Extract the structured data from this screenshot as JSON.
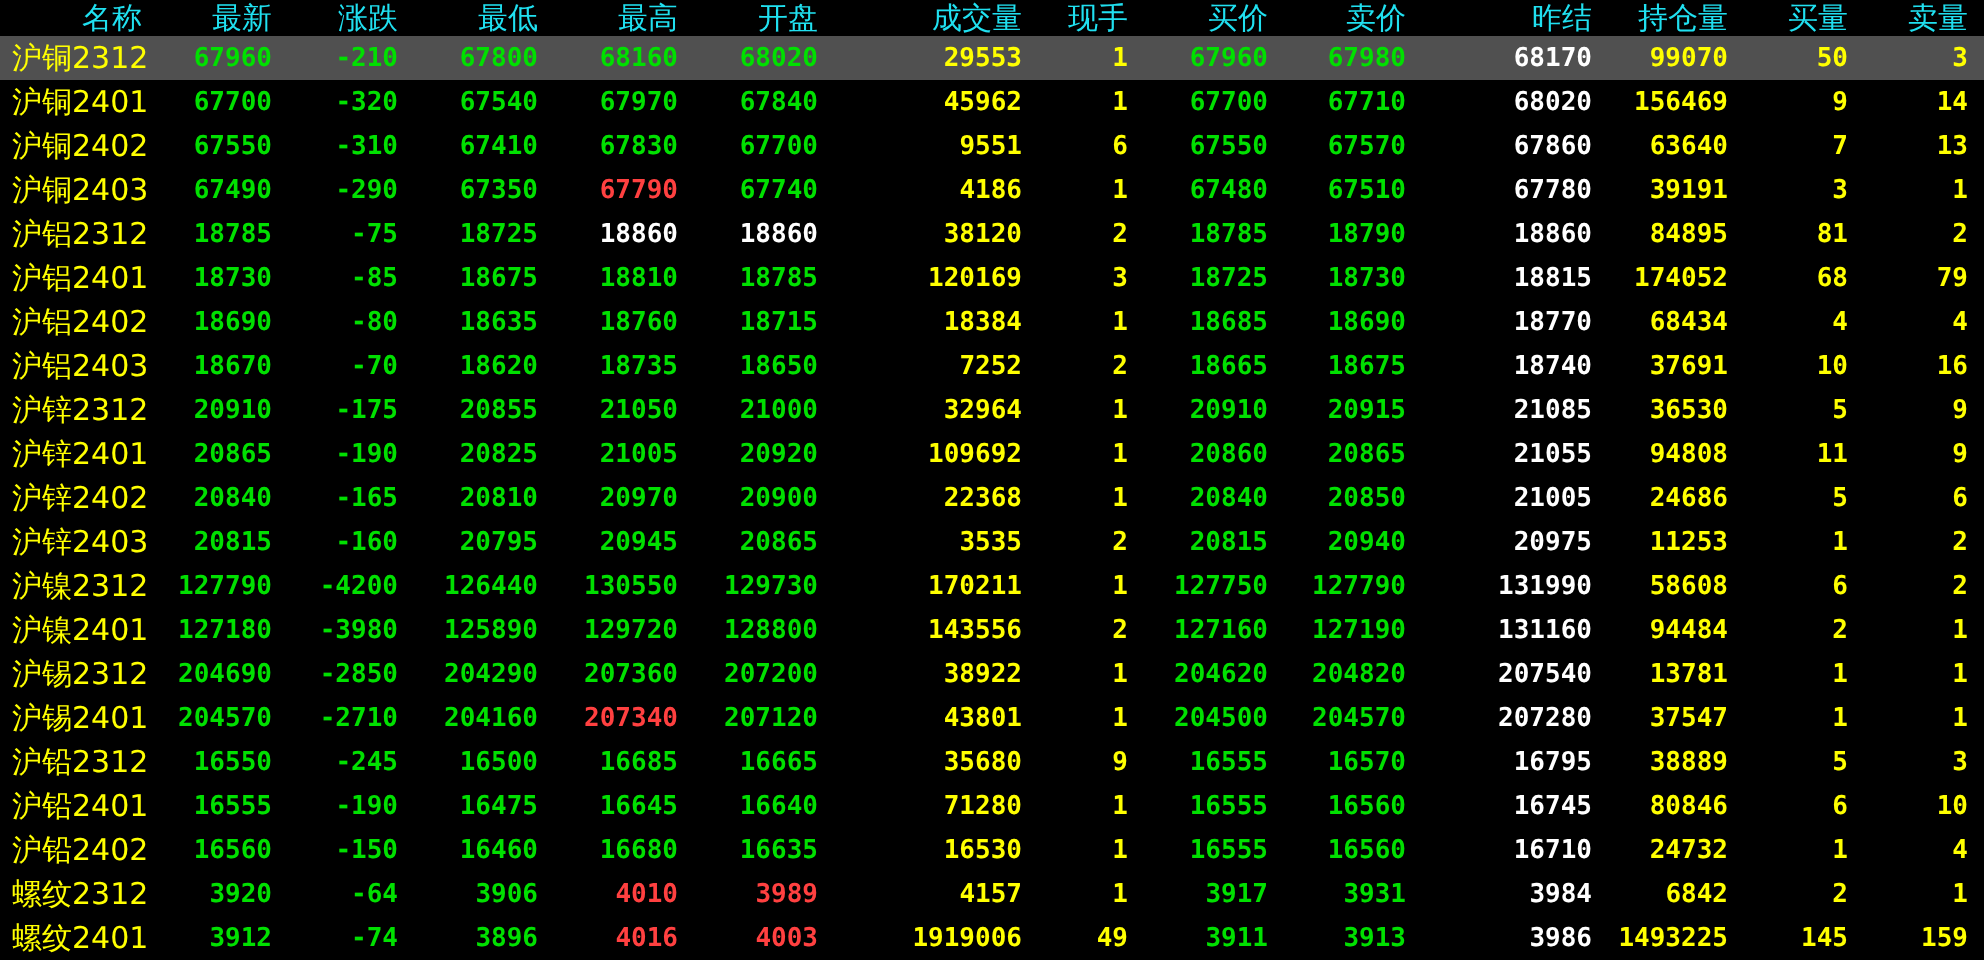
{
  "columns": [
    {
      "label": "名称"
    },
    {
      "label": "最新",
      "color": "#00e000"
    },
    {
      "label": "涨跌",
      "color": "#00e000"
    },
    {
      "label": "最低"
    },
    {
      "label": "最高"
    },
    {
      "label": "开盘"
    },
    {
      "label": "成交量",
      "color": "#ffff00"
    },
    {
      "label": "现手",
      "color": "#ffff00"
    },
    {
      "label": "买价",
      "color": "#00e000"
    },
    {
      "label": "卖价",
      "color": "#00e000"
    },
    {
      "label": "昨结",
      "color": "#ffffff"
    },
    {
      "label": "持仓量",
      "color": "#ffff00"
    },
    {
      "label": "买量",
      "color": "#ffff00"
    },
    {
      "label": "卖量",
      "color": "#ffff00"
    }
  ],
  "rows": [
    {
      "name": "沪铜2312",
      "selected": true,
      "cells": [
        "67960",
        "-210",
        {
          "text": "67800",
          "color": "#00e000"
        },
        {
          "text": "68160",
          "color": "#00e000"
        },
        {
          "text": "68020",
          "color": "#00e000"
        },
        "29553",
        "1",
        "67960",
        "67980",
        "68170",
        "99070",
        "50",
        "3"
      ]
    },
    {
      "name": "沪铜2401",
      "selected": false,
      "cells": [
        "67700",
        "-320",
        {
          "text": "67540",
          "color": "#00e000"
        },
        {
          "text": "67970",
          "color": "#00e000"
        },
        {
          "text": "67840",
          "color": "#00e000"
        },
        "45962",
        "1",
        "67700",
        "67710",
        "68020",
        "156469",
        "9",
        "14"
      ]
    },
    {
      "name": "沪铜2402",
      "selected": false,
      "cells": [
        "67550",
        "-310",
        {
          "text": "67410",
          "color": "#00e000"
        },
        {
          "text": "67830",
          "color": "#00e000"
        },
        {
          "text": "67700",
          "color": "#00e000"
        },
        "9551",
        "6",
        "67550",
        "67570",
        "67860",
        "63640",
        "7",
        "13"
      ]
    },
    {
      "name": "沪铜2403",
      "selected": false,
      "cells": [
        "67490",
        "-290",
        {
          "text": "67350",
          "color": "#00e000"
        },
        {
          "text": "67790",
          "color": "#ff4040"
        },
        {
          "text": "67740",
          "color": "#00e000"
        },
        "4186",
        "1",
        "67480",
        "67510",
        "67780",
        "39191",
        "3",
        "1"
      ]
    },
    {
      "name": "沪铝2312",
      "selected": false,
      "cells": [
        "18785",
        "-75",
        {
          "text": "18725",
          "color": "#00e000"
        },
        {
          "text": "18860",
          "color": "#ffffff"
        },
        {
          "text": "18860",
          "color": "#ffffff"
        },
        "38120",
        "2",
        "18785",
        "18790",
        "18860",
        "84895",
        "81",
        "2"
      ]
    },
    {
      "name": "沪铝2401",
      "selected": false,
      "cells": [
        "18730",
        "-85",
        {
          "text": "18675",
          "color": "#00e000"
        },
        {
          "text": "18810",
          "color": "#00e000"
        },
        {
          "text": "18785",
          "color": "#00e000"
        },
        "120169",
        "3",
        "18725",
        "18730",
        "18815",
        "174052",
        "68",
        "79"
      ]
    },
    {
      "name": "沪铝2402",
      "selected": false,
      "cells": [
        "18690",
        "-80",
        {
          "text": "18635",
          "color": "#00e000"
        },
        {
          "text": "18760",
          "color": "#00e000"
        },
        {
          "text": "18715",
          "color": "#00e000"
        },
        "18384",
        "1",
        "18685",
        "18690",
        "18770",
        "68434",
        "4",
        "4"
      ]
    },
    {
      "name": "沪铝2403",
      "selected": false,
      "cells": [
        "18670",
        "-70",
        {
          "text": "18620",
          "color": "#00e000"
        },
        {
          "text": "18735",
          "color": "#00e000"
        },
        {
          "text": "18650",
          "color": "#00e000"
        },
        "7252",
        "2",
        "18665",
        "18675",
        "18740",
        "37691",
        "10",
        "16"
      ]
    },
    {
      "name": "沪锌2312",
      "selected": false,
      "cells": [
        "20910",
        "-175",
        {
          "text": "20855",
          "color": "#00e000"
        },
        {
          "text": "21050",
          "color": "#00e000"
        },
        {
          "text": "21000",
          "color": "#00e000"
        },
        "32964",
        "1",
        "20910",
        "20915",
        "21085",
        "36530",
        "5",
        "9"
      ]
    },
    {
      "name": "沪锌2401",
      "selected": false,
      "cells": [
        "20865",
        "-190",
        {
          "text": "20825",
          "color": "#00e000"
        },
        {
          "text": "21005",
          "color": "#00e000"
        },
        {
          "text": "20920",
          "color": "#00e000"
        },
        "109692",
        "1",
        "20860",
        "20865",
        "21055",
        "94808",
        "11",
        "9"
      ]
    },
    {
      "name": "沪锌2402",
      "selected": false,
      "cells": [
        "20840",
        "-165",
        {
          "text": "20810",
          "color": "#00e000"
        },
        {
          "text": "20970",
          "color": "#00e000"
        },
        {
          "text": "20900",
          "color": "#00e000"
        },
        "22368",
        "1",
        "20840",
        "20850",
        "21005",
        "24686",
        "5",
        "6"
      ]
    },
    {
      "name": "沪锌2403",
      "selected": false,
      "cells": [
        "20815",
        "-160",
        {
          "text": "20795",
          "color": "#00e000"
        },
        {
          "text": "20945",
          "color": "#00e000"
        },
        {
          "text": "20865",
          "color": "#00e000"
        },
        "3535",
        "2",
        "20815",
        "20940",
        "20975",
        "11253",
        "1",
        "2"
      ]
    },
    {
      "name": "沪镍2312",
      "selected": false,
      "cells": [
        "127790",
        "-4200",
        {
          "text": "126440",
          "color": "#00e000"
        },
        {
          "text": "130550",
          "color": "#00e000"
        },
        {
          "text": "129730",
          "color": "#00e000"
        },
        "170211",
        "1",
        "127750",
        "127790",
        "131990",
        "58608",
        "6",
        "2"
      ]
    },
    {
      "name": "沪镍2401",
      "selected": false,
      "cells": [
        "127180",
        "-3980",
        {
          "text": "125890",
          "color": "#00e000"
        },
        {
          "text": "129720",
          "color": "#00e000"
        },
        {
          "text": "128800",
          "color": "#00e000"
        },
        "143556",
        "2",
        "127160",
        "127190",
        "131160",
        "94484",
        "2",
        "1"
      ]
    },
    {
      "name": "沪锡2312",
      "selected": false,
      "cells": [
        "204690",
        "-2850",
        {
          "text": "204290",
          "color": "#00e000"
        },
        {
          "text": "207360",
          "color": "#00e000"
        },
        {
          "text": "207200",
          "color": "#00e000"
        },
        "38922",
        "1",
        "204620",
        "204820",
        "207540",
        "13781",
        "1",
        "1"
      ]
    },
    {
      "name": "沪锡2401",
      "selected": false,
      "cells": [
        "204570",
        "-2710",
        {
          "text": "204160",
          "color": "#00e000"
        },
        {
          "text": "207340",
          "color": "#ff4040"
        },
        {
          "text": "207120",
          "color": "#00e000"
        },
        "43801",
        "1",
        "204500",
        "204570",
        "207280",
        "37547",
        "1",
        "1"
      ]
    },
    {
      "name": "沪铅2312",
      "selected": false,
      "cells": [
        "16550",
        "-245",
        {
          "text": "16500",
          "color": "#00e000"
        },
        {
          "text": "16685",
          "color": "#00e000"
        },
        {
          "text": "16665",
          "color": "#00e000"
        },
        "35680",
        "9",
        "16555",
        "16570",
        "16795",
        "38889",
        "5",
        "3"
      ]
    },
    {
      "name": "沪铅2401",
      "selected": false,
      "cells": [
        "16555",
        "-190",
        {
          "text": "16475",
          "color": "#00e000"
        },
        {
          "text": "16645",
          "color": "#00e000"
        },
        {
          "text": "16640",
          "color": "#00e000"
        },
        "71280",
        "1",
        "16555",
        "16560",
        "16745",
        "80846",
        "6",
        "10"
      ]
    },
    {
      "name": "沪铅2402",
      "selected": false,
      "cells": [
        "16560",
        "-150",
        {
          "text": "16460",
          "color": "#00e000"
        },
        {
          "text": "16680",
          "color": "#00e000"
        },
        {
          "text": "16635",
          "color": "#00e000"
        },
        "16530",
        "1",
        "16555",
        "16560",
        "16710",
        "24732",
        "1",
        "4"
      ]
    },
    {
      "name": "螺纹2312",
      "selected": false,
      "cells": [
        "3920",
        "-64",
        {
          "text": "3906",
          "color": "#00e000"
        },
        {
          "text": "4010",
          "color": "#ff4040"
        },
        {
          "text": "3989",
          "color": "#ff4040"
        },
        "4157",
        "1",
        "3917",
        "3931",
        "3984",
        "6842",
        "2",
        "1"
      ]
    },
    {
      "name": "螺纹2401",
      "selected": false,
      "cells": [
        "3912",
        "-74",
        {
          "text": "3896",
          "color": "#00e000"
        },
        {
          "text": "4016",
          "color": "#ff4040"
        },
        {
          "text": "4003",
          "color": "#ff4040"
        },
        "1919006",
        "49",
        "3911",
        "3913",
        "3986",
        "1493225",
        "145",
        "159"
      ]
    }
  ]
}
